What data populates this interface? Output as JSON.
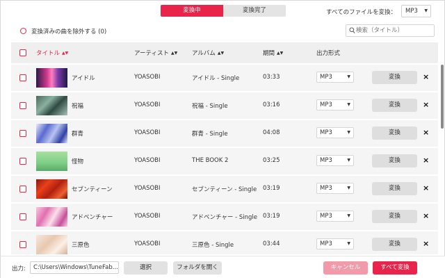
{
  "tabs": [
    {
      "label": "変換中",
      "active": true
    },
    {
      "label": "変換完了",
      "active": false
    }
  ],
  "convert_all_format": {
    "label": "すべてのファイルを変換：",
    "value": "MP3"
  },
  "filter": {
    "exclude_label": "変換済みの曲を除外する (0)"
  },
  "search": {
    "placeholder": "検索（タイトル）"
  },
  "columns": {
    "title": "タイトル",
    "artist": "アーティスト",
    "album": "アルバム",
    "duration": "期間",
    "format": "出力形式"
  },
  "rows": [
    {
      "title": "アイドル",
      "artist": "YOASOBI",
      "album": "アイドル - Single",
      "duration": "03:33",
      "format": "MP3",
      "convert": "変換"
    },
    {
      "title": "祝福",
      "artist": "YOASOBI",
      "album": "祝福 - Single",
      "duration": "03:16",
      "format": "MP3",
      "convert": "変換"
    },
    {
      "title": "群青",
      "artist": "YOASOBI",
      "album": "群青 - Single",
      "duration": "04:08",
      "format": "MP3",
      "convert": "変換"
    },
    {
      "title": "怪物",
      "artist": "YOASOBI",
      "album": "THE BOOK 2",
      "duration": "03:25",
      "format": "MP3",
      "convert": "変換"
    },
    {
      "title": "セブンティーン",
      "artist": "YOASOBI",
      "album": "セブンティーン - Single",
      "duration": "03:19",
      "format": "MP3",
      "convert": "変換"
    },
    {
      "title": "アドベンチャー",
      "artist": "YOASOBI",
      "album": "アドベンチャー - Single",
      "duration": "03:19",
      "format": "MP3",
      "convert": "変換"
    },
    {
      "title": "三原色",
      "artist": "YOASOBI",
      "album": "三原色 - Single",
      "duration": "03:44",
      "format": "MP3",
      "convert": "変換"
    }
  ],
  "footer": {
    "output_label": "出力:",
    "output_path": "C:\\Users\\Windows\\TuneFab...",
    "select_label": "選択",
    "open_folder_label": "フォルダを開く",
    "cancel_label": "キャンセル",
    "convert_all_label": "すべて変換"
  },
  "colors": {
    "accent": "#e8244b",
    "cancel": "#f29aaa",
    "row_bg": "#f5f5f5",
    "header_bg": "#efefef"
  }
}
